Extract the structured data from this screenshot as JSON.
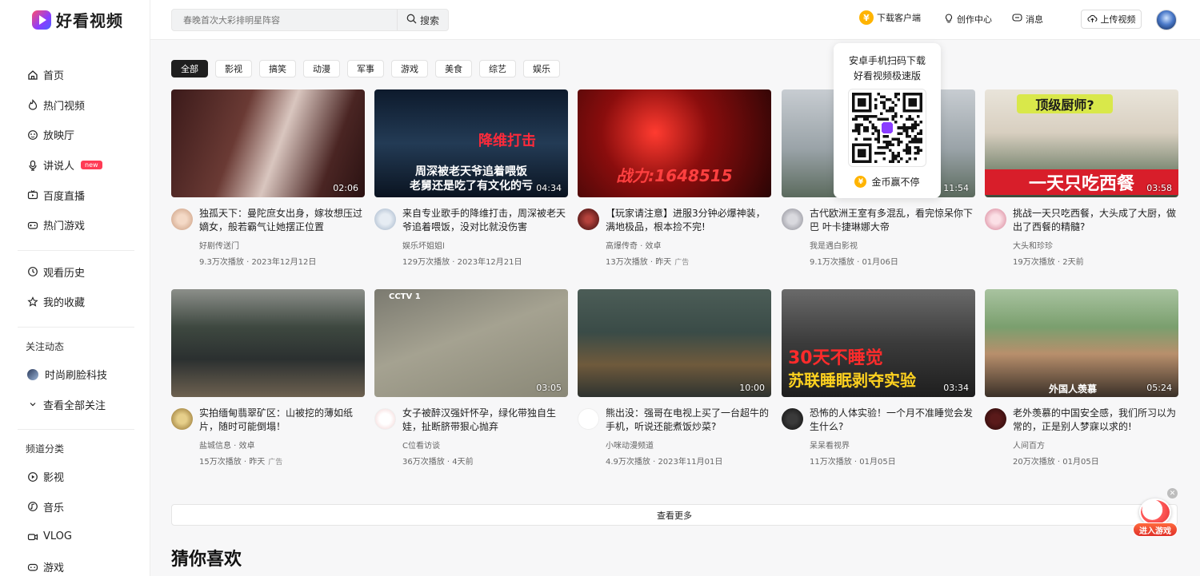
{
  "app": {
    "name": "好看视频"
  },
  "sidebar": {
    "main_items": [
      {
        "label": "首页",
        "icon": "home-icon"
      },
      {
        "label": "热门视频",
        "icon": "fire-icon"
      },
      {
        "label": "放映厅",
        "icon": "theater-icon"
      },
      {
        "label": "讲说人",
        "icon": "mic-icon",
        "badge": "new"
      },
      {
        "label": "百度直播",
        "icon": "live-icon"
      },
      {
        "label": "热门游戏",
        "icon": "gamepad-icon"
      }
    ],
    "personal_items": [
      {
        "label": "观看历史",
        "icon": "clock-icon"
      },
      {
        "label": "我的收藏",
        "icon": "star-icon"
      }
    ],
    "follow_heading": "关注动态",
    "follow_items": [
      {
        "label": "时尚刷脸科技"
      },
      {
        "label": "查看全部关注"
      }
    ],
    "channel_heading": "频道分类",
    "channel_items": [
      {
        "label": "影视",
        "icon": "play-circle-icon"
      },
      {
        "label": "音乐",
        "icon": "music-icon"
      },
      {
        "label": "VLOG",
        "icon": "camera-icon"
      },
      {
        "label": "游戏",
        "icon": "game-icon"
      }
    ]
  },
  "header": {
    "search_placeholder": "春晚首次大彩排明星阵容",
    "search_button": "搜索",
    "download": "下载客户端",
    "creator": "创作中心",
    "messages": "消息",
    "upload": "上传视频"
  },
  "qr_popup": {
    "line1": "安卓手机扫码下载",
    "line2": "好看视频极速版",
    "coin_text": "金币赢不停"
  },
  "tabs": [
    "全部",
    "影视",
    "搞笑",
    "动漫",
    "军事",
    "游戏",
    "美食",
    "综艺",
    "娱乐"
  ],
  "videos": [
    {
      "title": "独孤天下：曼陀庶女出身，嫁妆想压过嫡女，般若霸气让她摆正位置",
      "author": "好剧传送门",
      "stats": "9.3万次播放 · 2023年12月12日",
      "duration": "02:06",
      "ad": ""
    },
    {
      "title": "来自专业歌手的降维打击，周深被老天爷追着喂饭，没对比就没伤害",
      "author": "娱乐坏姐姐l",
      "stats": "129万次播放 · 2023年12月21日",
      "duration": "04:34",
      "ad": "",
      "thumb_text1": "降维打击",
      "thumb_text2": "周深被老天爷追着喂饭",
      "thumb_text3": "老舅还是吃了有文化的亏"
    },
    {
      "title": "【玩家请注意】进服3分钟必爆神装，满地极品，根本捡不完!",
      "author": "高爆传奇 · 效卓",
      "stats": "13万次播放 · 昨天",
      "duration": "",
      "ad": "广告",
      "thumb_text1": "战力:1648515"
    },
    {
      "title": "古代欧洲王室有多混乱，看完惊呆你下巴 叶卡捷琳娜大帝",
      "author": "我是遇白影视",
      "stats": "9.1万次播放 · 01月06日",
      "duration": "11:54",
      "ad": ""
    },
    {
      "title": "挑战一天只吃西餐，大头成了大厨，做出了西餐的精髓?",
      "author": "大头和珍珍",
      "stats": "19万次播放 · 2天前",
      "duration": "03:58",
      "ad": "",
      "thumb_text1": "顶级厨师?",
      "thumb_text2": "一天只吃西餐"
    },
    {
      "title": "实拍缅甸翡翠矿区：山被挖的薄如纸片，随时可能倒塌！",
      "author": "盐城信息 · 效卓",
      "stats": "15万次播放 · 昨天",
      "duration": "",
      "ad": "广告"
    },
    {
      "title": "女子被醉汉强奸怀孕，绿化带独自生娃，扯断脐带狠心抛弃",
      "author": "C位看访谈",
      "stats": "36万次播放 · 4天前",
      "duration": "03:05",
      "ad": "",
      "thumb_text1": "CCTV 1"
    },
    {
      "title": "熊出没：强哥在电视上买了一台超牛的手机，听说还能煮饭炒菜?",
      "author": "小咪动漫频道",
      "stats": "4.9万次播放 · 2023年11月01日",
      "duration": "10:00",
      "ad": ""
    },
    {
      "title": "恐怖的人体实验！一个月不准睡觉会发生什么?",
      "author": "呆呆看视界",
      "stats": "11万次播放 · 01月05日",
      "duration": "03:34",
      "ad": "",
      "thumb_text1": "30天不睡觉",
      "thumb_text2": "苏联睡眠剥夺实验"
    },
    {
      "title": "老外羡慕的中国安全感，我们所习以为常的，正是别人梦寐以求的!",
      "author": "人间百方",
      "stats": "20万次播放 · 01月05日",
      "duration": "05:24",
      "ad": "",
      "thumb_text1": "外国人羡慕"
    }
  ],
  "see_more": "查看更多",
  "section_title": "猜你喜欢",
  "game_badge": "进入游戏"
}
